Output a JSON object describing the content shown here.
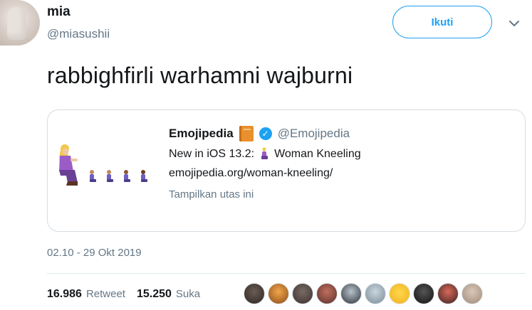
{
  "author": {
    "name": "mia",
    "handle": "@miasushii"
  },
  "follow_button": {
    "label": "Ikuti"
  },
  "tweet": {
    "text": "rabbighfirli warhamni wajburni",
    "timestamp": "02.10 - 29 Okt 2019"
  },
  "quoted": {
    "name": "Emojipedia",
    "handle": "@Emojipedia",
    "line1_prefix": "New in iOS 13.2:",
    "line1_suffix": "Woman Kneeling",
    "link": "emojipedia.org/woman-kneeling/",
    "thread_label": "Tampilkan utas ini",
    "icons": [
      "book-emoji-icon",
      "verified-badge-icon",
      "woman-kneeling-emoji-icon"
    ]
  },
  "stats": {
    "retweets": "16.986",
    "retweets_label": "Retweet",
    "likes": "15.250",
    "likes_label": "Suka"
  },
  "likers": {
    "count": 10
  },
  "colors": {
    "accent": "#1da1f2",
    "muted": "#657786",
    "text": "#14171a",
    "card_border": "#d6dde3"
  }
}
